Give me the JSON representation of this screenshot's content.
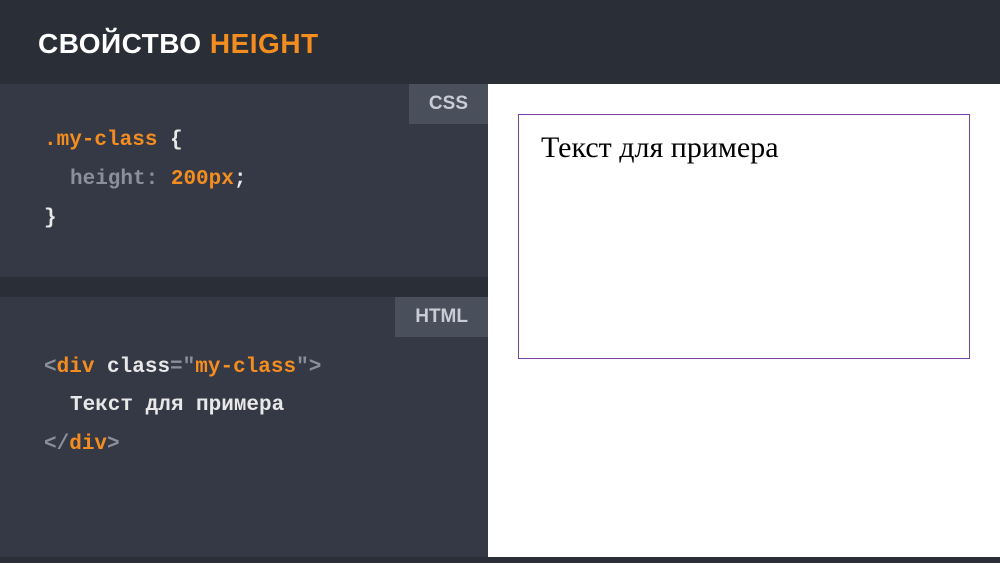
{
  "header": {
    "title_prefix": "СВОЙСТВО ",
    "title_accent": "HEIGHT"
  },
  "css_block": {
    "label": "CSS",
    "selector": ".my-class",
    "brace_open": "{",
    "property": "height",
    "colon": ":",
    "value": "200px",
    "semicolon": ";",
    "brace_close": "}"
  },
  "html_block": {
    "label": "HTML",
    "open_lt": "<",
    "tag": "div",
    "attr_name": "class",
    "attr_eq": "=",
    "attr_quote_open": "\"",
    "attr_value": "my-class",
    "attr_quote_close": "\"",
    "open_gt": ">",
    "text_content": "Текст для примера",
    "close_lt": "</",
    "close_gt": ">"
  },
  "preview": {
    "text": "Текст для примера"
  }
}
